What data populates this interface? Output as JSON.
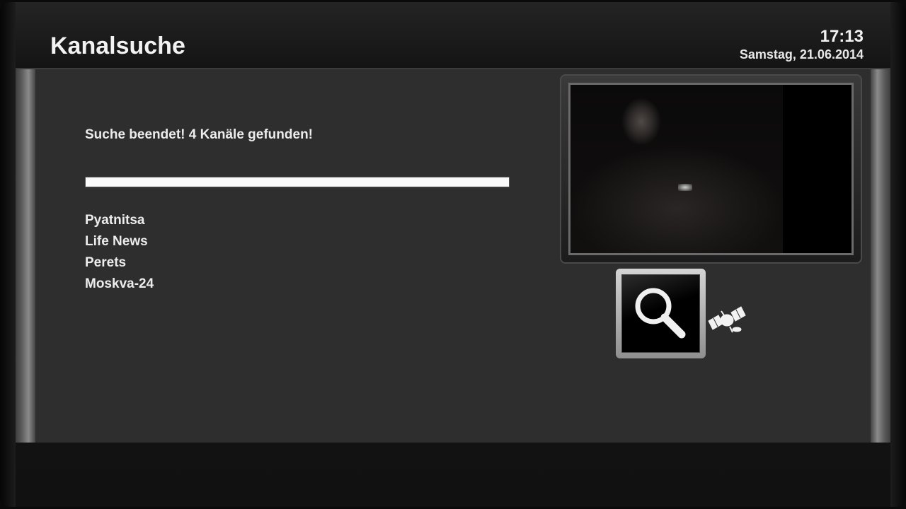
{
  "header": {
    "title": "Kanalsuche",
    "time": "17:13",
    "date": "Samstag, 21.06.2014"
  },
  "scan": {
    "status_text": "Suche beendet! 4 Kanäle gefunden!",
    "progress_percent": 100,
    "channels": [
      "Pyatnitsa",
      "Life News",
      "Perets",
      "Moskva-24"
    ]
  },
  "icons": {
    "search": "search-icon",
    "satellite": "satellite-icon"
  },
  "colors": {
    "background": "#2e2e2e",
    "text": "#ececec",
    "progress_fill": "#fafafa"
  }
}
